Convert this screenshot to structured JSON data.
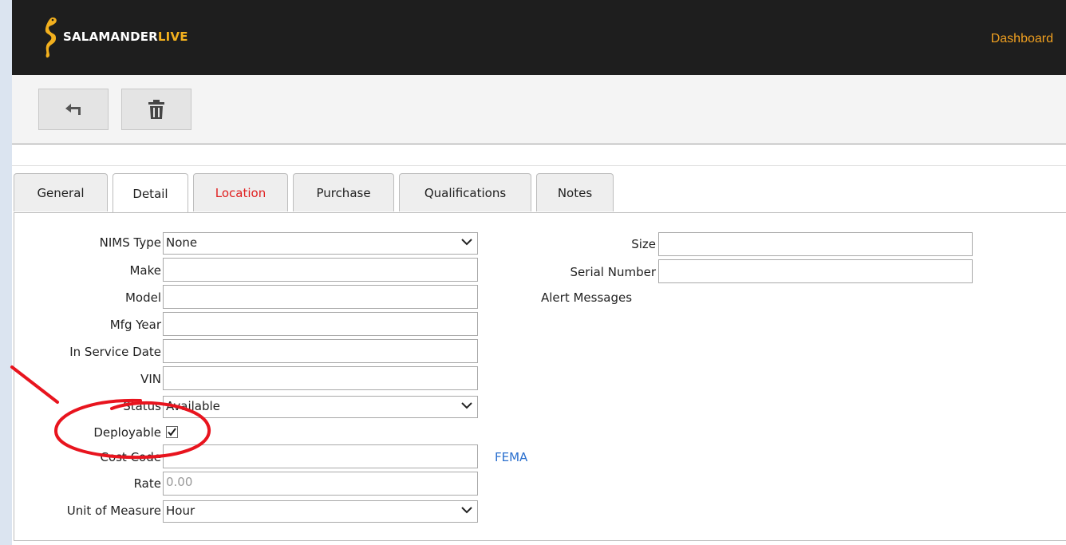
{
  "header": {
    "logo_text_a": "SALAMANDER",
    "logo_text_b": "LIVE",
    "dashboard_link": "Dashboard"
  },
  "toolbar": {
    "back_icon": "back-arrow-icon",
    "delete_icon": "trash-icon"
  },
  "tabs": [
    {
      "label": "General"
    },
    {
      "label": "Detail"
    },
    {
      "label": "Location"
    },
    {
      "label": "Purchase"
    },
    {
      "label": "Qualifications"
    },
    {
      "label": "Notes"
    }
  ],
  "active_tab": "Detail",
  "colors": {
    "header_bg": "#1e1e1e",
    "brand_accent": "#f2b01e",
    "link_orange": "#f0a020",
    "tab_alert": "#e02020",
    "fema_link": "#2a6fce",
    "annotation": "#e8141e"
  },
  "form": {
    "nims_type": {
      "label": "NIMS Type",
      "value": "None"
    },
    "make": {
      "label": "Make",
      "value": ""
    },
    "model": {
      "label": "Model",
      "value": ""
    },
    "mfg_year": {
      "label": "Mfg Year",
      "value": ""
    },
    "in_service_date": {
      "label": "In Service Date",
      "value": ""
    },
    "vin": {
      "label": "VIN",
      "value": ""
    },
    "status": {
      "label": "Status",
      "value": "Available"
    },
    "deployable": {
      "label": "Deployable",
      "checked": true
    },
    "cost_code": {
      "label": "Cost Code",
      "value": ""
    },
    "fema_link": "FEMA",
    "rate": {
      "label": "Rate",
      "placeholder": "0.00"
    },
    "unit_of_measure": {
      "label": "Unit of Measure",
      "value": "Hour"
    },
    "size": {
      "label": "Size",
      "value": ""
    },
    "serial_number": {
      "label": "Serial Number",
      "value": ""
    },
    "alert_messages": {
      "label": "Alert Messages"
    }
  }
}
